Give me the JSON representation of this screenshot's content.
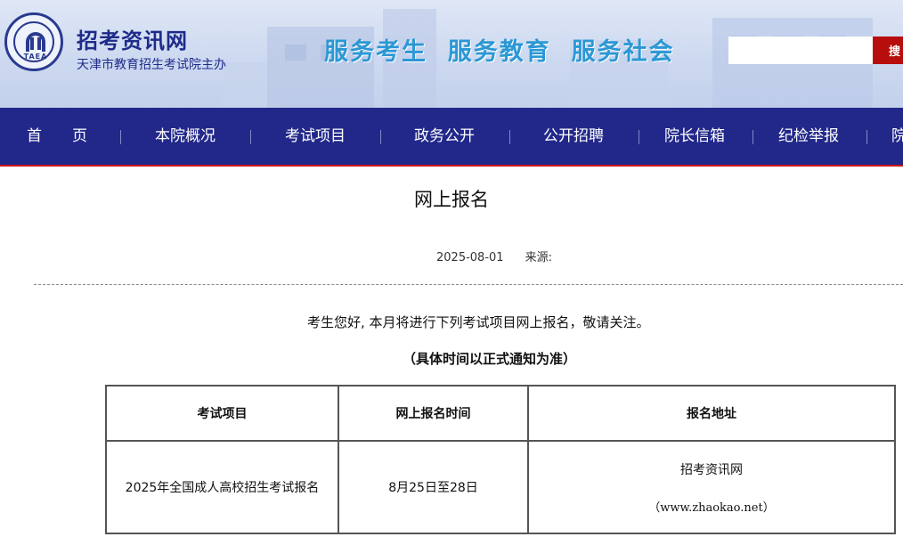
{
  "header": {
    "logo_text": "TAEA",
    "site_name": "招考资讯网",
    "site_sub": "天津市教育招生考试院主办",
    "slogan": "服务考生  服务教育  服务社会",
    "search": {
      "value": "",
      "placeholder": "",
      "button_label": "搜"
    }
  },
  "nav": {
    "items": [
      {
        "label": "首　　页"
      },
      {
        "label": "本院概况"
      },
      {
        "label": "考试项目"
      },
      {
        "label": "政务公开"
      },
      {
        "label": "公开招聘"
      },
      {
        "label": "院长信箱"
      },
      {
        "label": "纪检举报"
      },
      {
        "label": "院"
      }
    ]
  },
  "article": {
    "title": "网上报名",
    "date": "2025-08-01",
    "source_label": "来源:",
    "intro": "考生您好, 本月将进行下列考试项目网上报名，敬请关注。",
    "note": "（具体时间以正式通知为准）",
    "table": {
      "headers": [
        "考试项目",
        "网上报名时间",
        "报名地址"
      ],
      "rows": [
        {
          "project": "2025年全国成人高校招生考试报名",
          "time": "8月25日至28日",
          "address_name": "招考资讯网",
          "address_url": "（www.zhaokao.net）"
        }
      ]
    }
  },
  "colors": {
    "nav_bg": "#22288a",
    "nav_border": "#c9141b",
    "slogan": "#2b98d4",
    "brand_text": "#1e2b8a",
    "search_button": "#b80d0d"
  }
}
